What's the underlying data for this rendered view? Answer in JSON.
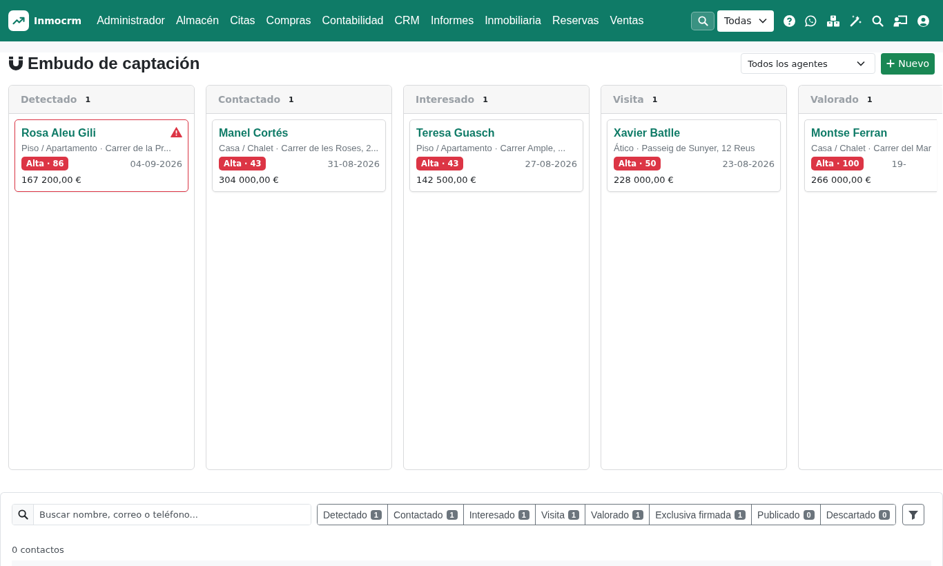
{
  "app": {
    "name": "Inmocrm"
  },
  "nav": [
    "Administrador",
    "Almacén",
    "Citas",
    "Compras",
    "Contabilidad",
    "CRM",
    "Informes",
    "Inmobiliaria",
    "Reservas",
    "Ventas"
  ],
  "scope_select": {
    "value": "Todas"
  },
  "page": {
    "title": "Embudo de captación",
    "agent_select": {
      "value": "Todos los agentes"
    },
    "new_button": "Nuevo"
  },
  "columns": [
    {
      "title": "Detectado",
      "count": "1",
      "cards": [
        {
          "name": "Rosa Aleu Gili",
          "alert": true,
          "detail": "Piso / Apartamento · Carrer de la Pr...",
          "priority": "Alta · 86",
          "date": "04-09-2026",
          "price": "167 200,00 €"
        }
      ]
    },
    {
      "title": "Contactado",
      "count": "1",
      "cards": [
        {
          "name": "Manel Cortés",
          "alert": false,
          "detail": "Casa / Chalet · Carrer de les Roses, 2...",
          "priority": "Alta · 43",
          "date": "31-08-2026",
          "price": "304 000,00 €"
        }
      ]
    },
    {
      "title": "Interesado",
      "count": "1",
      "cards": [
        {
          "name": "Teresa Guasch",
          "alert": false,
          "detail": "Piso / Apartamento · Carrer Ample, ...",
          "priority": "Alta · 43",
          "date": "27-08-2026",
          "price": "142 500,00 €"
        }
      ]
    },
    {
      "title": "Visita",
      "count": "1",
      "cards": [
        {
          "name": "Xavier Batlle",
          "alert": false,
          "detail": "Ático · Passeig de Sunyer, 12 Reus",
          "priority": "Alta · 50",
          "date": "23-08-2026",
          "price": "228 000,00 €"
        }
      ]
    },
    {
      "title": "Valorado",
      "count": "1",
      "cards": [
        {
          "name": "Montse Ferran",
          "alert": false,
          "detail": "Casa / Chalet · Carrer del Mar",
          "priority": "Alta · 100",
          "date": "19-",
          "price": "266 000,00 €"
        }
      ]
    }
  ],
  "search": {
    "placeholder": "Buscar nombre, correo o teléfono..."
  },
  "stage_filters": [
    {
      "label": "Detectado",
      "count": "1"
    },
    {
      "label": "Contactado",
      "count": "1"
    },
    {
      "label": "Interesado",
      "count": "1"
    },
    {
      "label": "Visita",
      "count": "1"
    },
    {
      "label": "Valorado",
      "count": "1"
    },
    {
      "label": "Exclusiva firmada",
      "count": "1"
    },
    {
      "label": "Publicado",
      "count": "0"
    },
    {
      "label": "Descartado",
      "count": "0"
    }
  ],
  "result_count": "0 contactos"
}
